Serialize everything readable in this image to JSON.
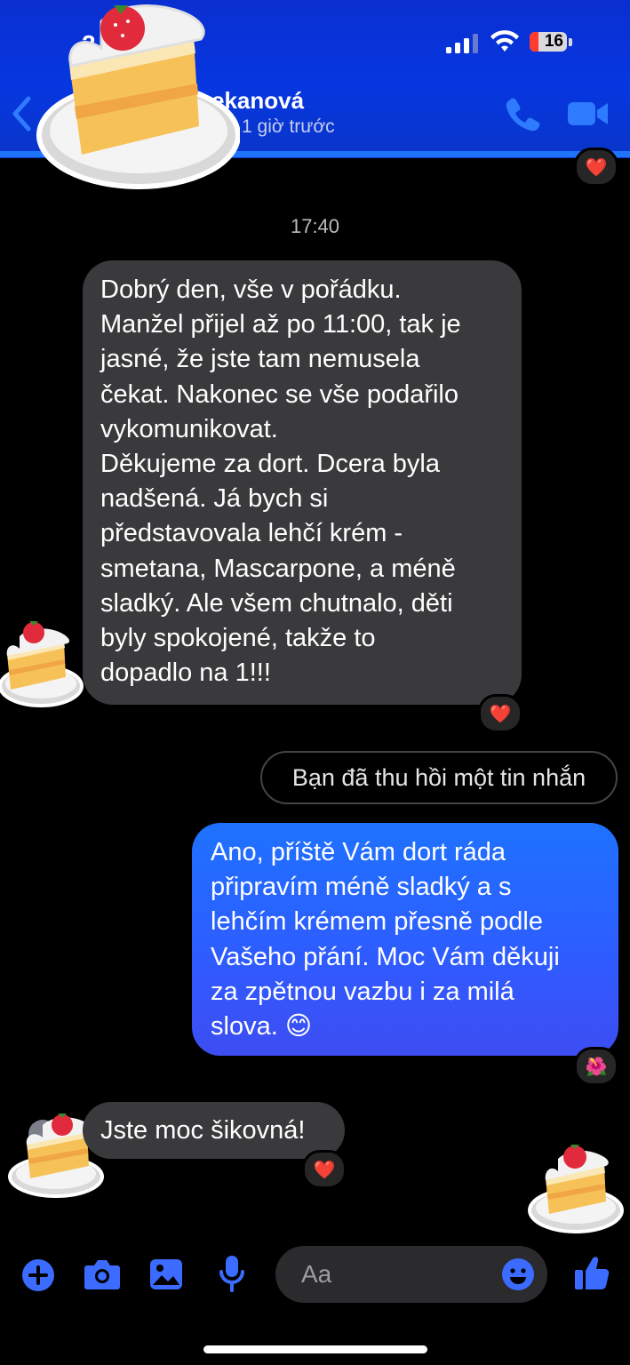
{
  "status_bar": {
    "time": "2",
    "battery": "16"
  },
  "header": {
    "contact_name": "ekanová",
    "contact_status": "1 giờ trước",
    "call_icon": "phone-icon",
    "video_icon": "video-camera-icon",
    "back_icon": "chevron-left-icon"
  },
  "conversation": {
    "timestamp": "17:40",
    "messages": [
      {
        "direction": "in",
        "text": "Dobrý den, vše v pořádku.\nManžel přijel až po 11:00, tak je\njasné, že jste tam nemusela\nčekat. Nakonec se vše podařilo\nvykomunikovat.\nDěkujeme za dort. Dcera byla\nnadšená. Já bych si\npředstavovala lehčí krém -\nsmetana, Mascarpone, a méně\nsladký. Ale všem chutnalo, děti\nbyly spokojené, takže to\ndopadlo na 1!!!",
        "reaction": "❤️"
      },
      {
        "direction": "system",
        "text": "Bạn đã thu hồi một tin nhắn"
      },
      {
        "direction": "out",
        "text": "Ano, příště Vám dort ráda\npřipravím méně sladký a s\nlehčím krémem přesně podle\nVašeho přání. Moc Vám děkuji\nza zpětnou vazbu i za milá\nslova. 😊",
        "reaction": "🌺"
      },
      {
        "direction": "in",
        "text": "Jste moc šikovná!",
        "reaction": "❤️"
      }
    ],
    "top_reaction": "❤️"
  },
  "composer": {
    "placeholder": "Aa",
    "icons": [
      "plus-icon",
      "camera-icon",
      "image-icon",
      "microphone-icon",
      "emoji-icon",
      "thumbs-up-icon"
    ]
  },
  "colors": {
    "accent": "#1f73ff",
    "header_bg": "#0637e0",
    "incoming_bubble": "#3a3a3c",
    "outgoing_bubble": "#2f5bff",
    "composer_icon": "#3b6bff"
  }
}
